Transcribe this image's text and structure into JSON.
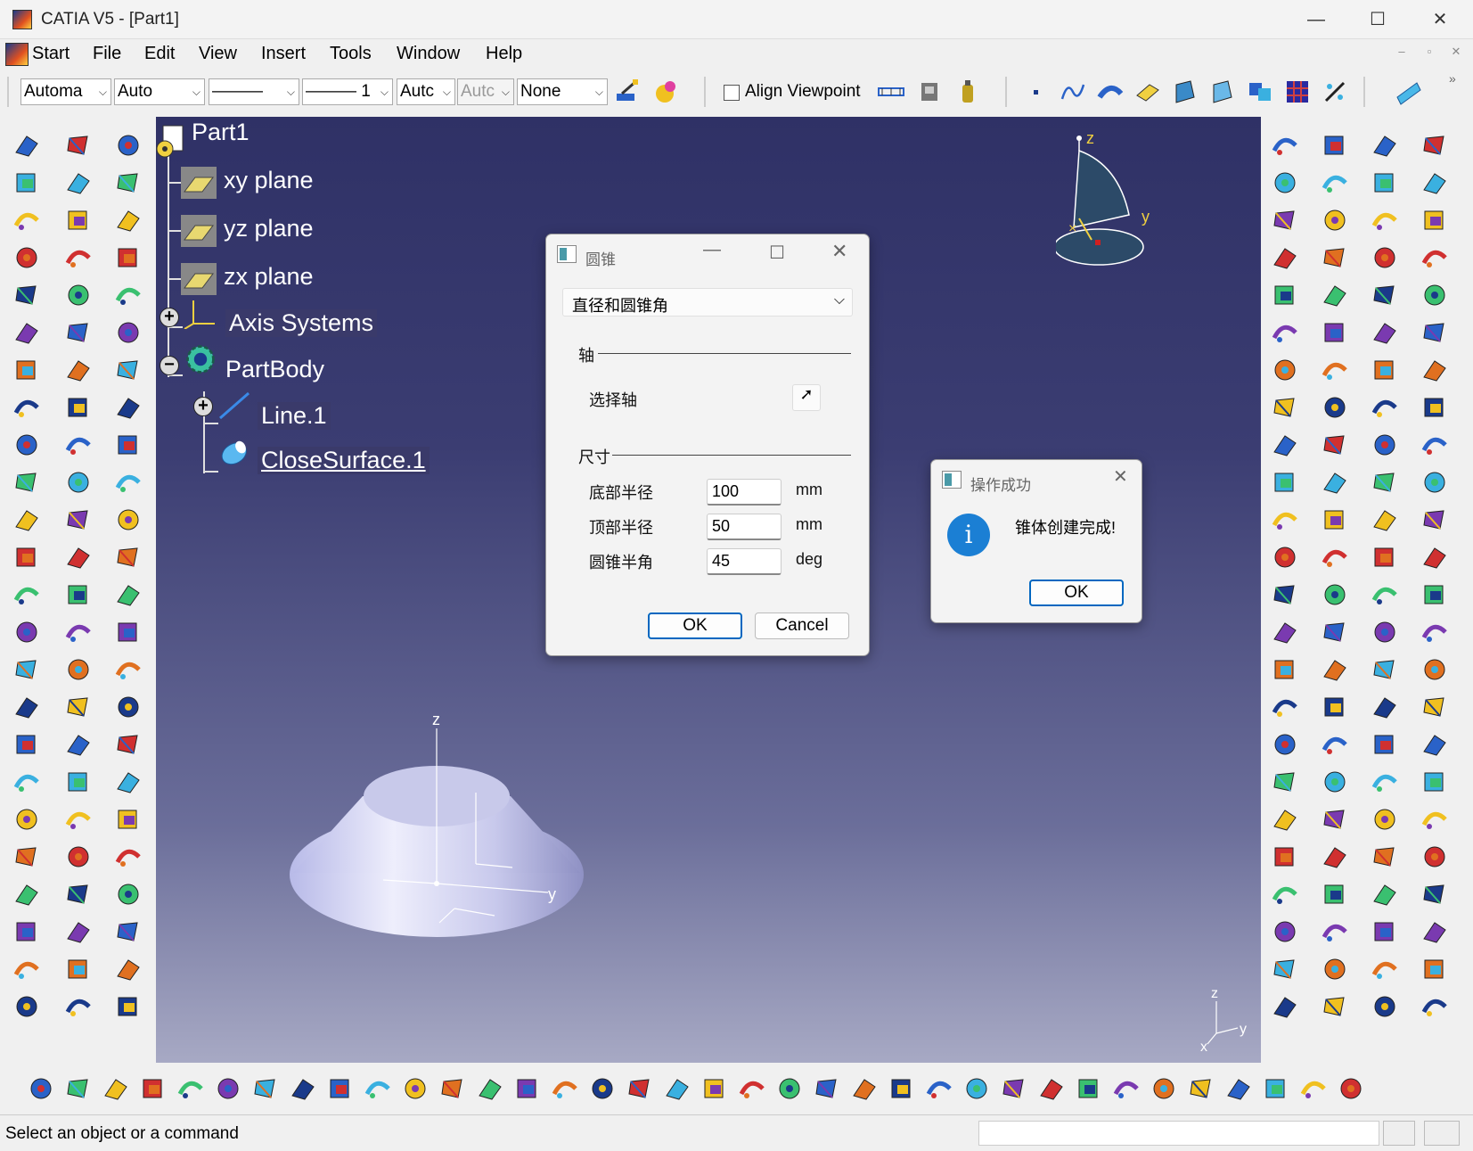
{
  "window": {
    "title": "CATIA V5 - [Part1]"
  },
  "menu": {
    "start": "Start",
    "file": "File",
    "edit": "Edit",
    "view": "View",
    "insert": "Insert",
    "tools": "Tools",
    "window": "Window",
    "help": "Help"
  },
  "toolbar": {
    "combo1": "Automa",
    "combo2": "Auto",
    "combo3": "———",
    "combo4": "——— 1",
    "combo5": "Autc",
    "combo6": "Autc",
    "combo7": "None",
    "align_viewpoint": "Align Viewpoint"
  },
  "tree": {
    "root": "Part1",
    "items": [
      "xy plane",
      "yz plane",
      "zx plane",
      "Axis Systems",
      "PartBody",
      "Line.1",
      "CloseSurface.1"
    ]
  },
  "compass": {
    "z": "z",
    "y": "y"
  },
  "model_axes": {
    "z": "z",
    "y": "y"
  },
  "corner_axes": {
    "z": "z",
    "y": "y",
    "x": "x"
  },
  "cone_dialog": {
    "title": "圆锥",
    "mode": "直径和圆锥角",
    "axis_section": "轴",
    "select_axis": "选择轴",
    "dim_section": "尺寸",
    "bottom_radius_label": "底部半径",
    "bottom_radius": "100",
    "bottom_unit": "mm",
    "top_radius_label": "顶部半径",
    "top_radius": "50",
    "top_unit": "mm",
    "half_angle_label": "圆锥半角",
    "half_angle": "45",
    "angle_unit": "deg",
    "ok": "OK",
    "cancel": "Cancel"
  },
  "success_dialog": {
    "title": "操作成功",
    "message": "锥体创建完成!",
    "ok": "OK"
  },
  "status": {
    "message": "Select an object or a command"
  },
  "colors": {
    "viewport_top": "#2f3166",
    "viewport_bottom": "#a7a9c4",
    "accent": "#0067c0",
    "info": "#1b7fd4"
  }
}
